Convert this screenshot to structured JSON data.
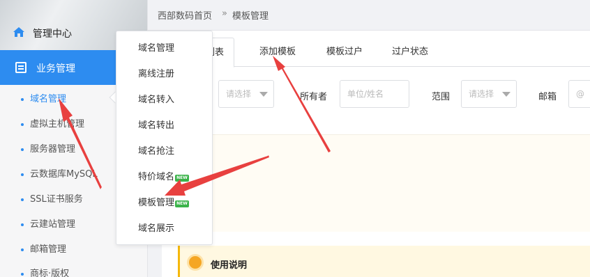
{
  "sidebar": {
    "title": "管理中心",
    "section": "业务管理",
    "items": [
      "域名管理",
      "虚拟主机管理",
      "服务器管理",
      "云数据库MySQL",
      "SSL证书服务",
      "云建站管理",
      "邮箱管理",
      "商标·版权"
    ],
    "active_index": 0
  },
  "breadcrumb": {
    "home": "西部数码首页",
    "separator": "»",
    "current": "模板管理"
  },
  "tabs": [
    {
      "label": "列表",
      "active": true
    },
    {
      "label": "添加模板",
      "active": false
    },
    {
      "label": "模板过户",
      "active": false
    },
    {
      "label": "过户状态",
      "active": false
    }
  ],
  "filters": {
    "select1_placeholder": "请选择",
    "owner_label": "所有者",
    "owner_placeholder": "单位/姓名",
    "range_label": "范围",
    "range_placeholder": "请选择",
    "email_label": "邮箱",
    "email_placeholder": "@"
  },
  "usage": {
    "title": "使用说明"
  },
  "dropdown": {
    "items": [
      {
        "label": "域名管理",
        "new": false
      },
      {
        "label": "离线注册",
        "new": false
      },
      {
        "label": "域名转入",
        "new": false
      },
      {
        "label": "域名转出",
        "new": false
      },
      {
        "label": "域名抢注",
        "new": false
      },
      {
        "label": "特价域名",
        "new": true
      },
      {
        "label": "模板管理",
        "new": true
      },
      {
        "label": "域名展示",
        "new": false
      }
    ],
    "badge_text": "NEW"
  },
  "colors": {
    "accent": "#2d8cf0",
    "annotation": "#e8403f",
    "badge": "#3bb34a",
    "notice": "#f5b80c"
  }
}
